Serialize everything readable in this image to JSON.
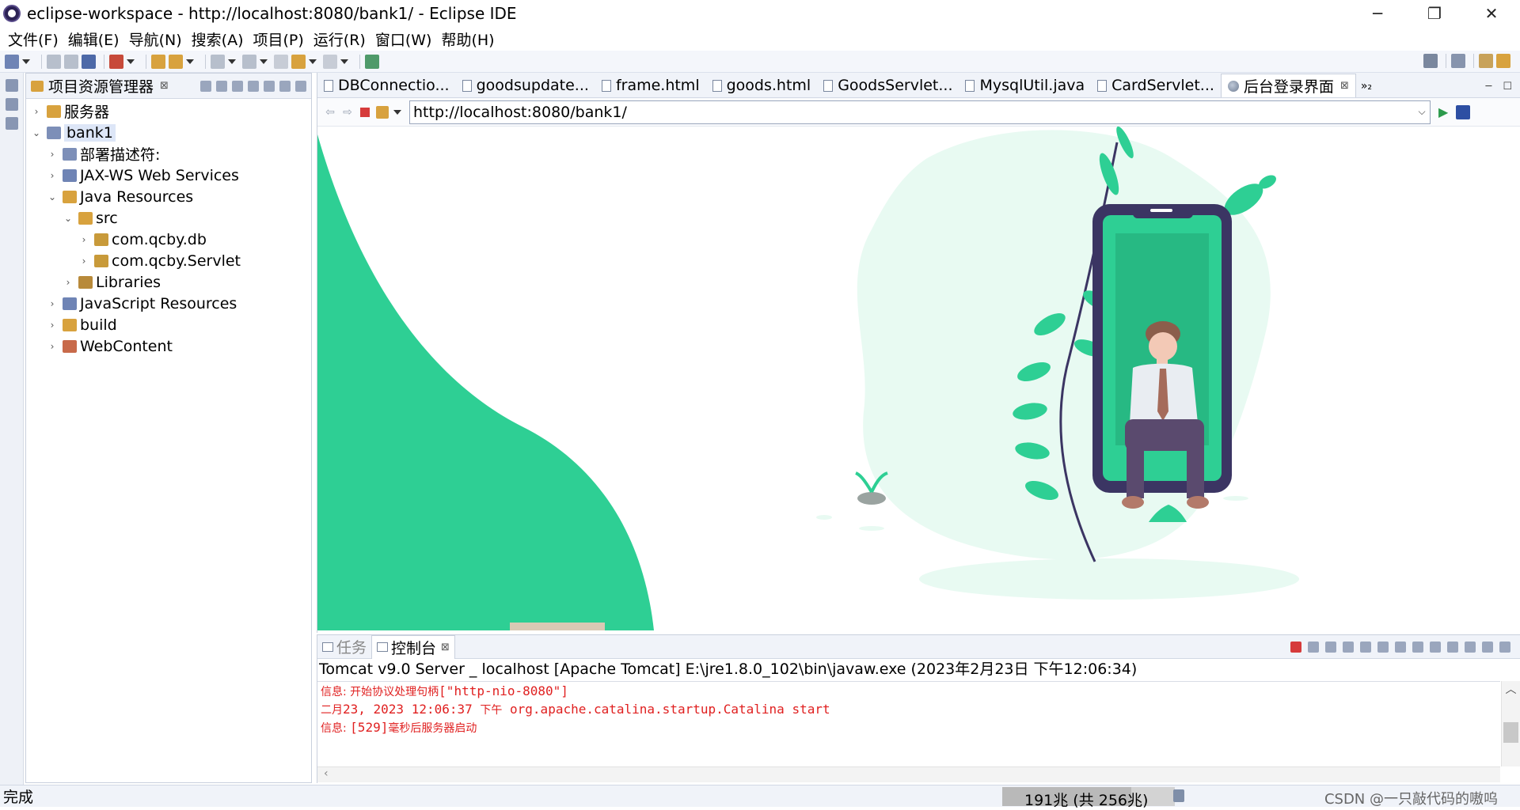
{
  "window": {
    "title": "eclipse-workspace - http://localhost:8080/bank1/ - Eclipse IDE",
    "minimize": "─",
    "maximize": "❐",
    "close": "✕"
  },
  "menubar": {
    "items": [
      {
        "label": "文件(F)"
      },
      {
        "label": "编辑(E)"
      },
      {
        "label": "导航(N)"
      },
      {
        "label": "搜索(A)"
      },
      {
        "label": "项目(P)"
      },
      {
        "label": "运行(R)"
      },
      {
        "label": "窗口(W)"
      },
      {
        "label": "帮助(H)"
      }
    ]
  },
  "explorer": {
    "title": "项目资源管理器",
    "close": "⊠",
    "tree": [
      {
        "label": "服务器",
        "twisty": "›",
        "icon": "folder-icon",
        "color": "#d8a23e",
        "indent": 0
      },
      {
        "label": "bank1",
        "twisty": "⌄",
        "icon": "web-project-icon",
        "color": "#7d8fb8",
        "indent": 0,
        "selected": true
      },
      {
        "label": "部署描述符:",
        "twisty": "›",
        "icon": "deployment-descriptor-icon",
        "color": "#7d8fb8",
        "indent": 1
      },
      {
        "label": "JAX-WS Web Services",
        "twisty": "›",
        "icon": "webservices-icon",
        "color": "#6f84b5",
        "indent": 1
      },
      {
        "label": "Java Resources",
        "twisty": "⌄",
        "icon": "java-resources-icon",
        "color": "#d8a23e",
        "indent": 1
      },
      {
        "label": "src",
        "twisty": "⌄",
        "icon": "source-folder-icon",
        "color": "#d8a23e",
        "indent": 2
      },
      {
        "label": "com.qcby.db",
        "twisty": "›",
        "icon": "package-icon",
        "color": "#c89a3a",
        "indent": 3
      },
      {
        "label": "com.qcby.Servlet",
        "twisty": "›",
        "icon": "package-icon",
        "color": "#c89a3a",
        "indent": 3
      },
      {
        "label": "Libraries",
        "twisty": "›",
        "icon": "libraries-icon",
        "color": "#b88a3a",
        "indent": 2
      },
      {
        "label": "JavaScript Resources",
        "twisty": "›",
        "icon": "js-resources-icon",
        "color": "#6f84b5",
        "indent": 1
      },
      {
        "label": "build",
        "twisty": "›",
        "icon": "folder-icon",
        "color": "#d8a23e",
        "indent": 1
      },
      {
        "label": "WebContent",
        "twisty": "›",
        "icon": "webcontent-folder-icon",
        "color": "#c86a4a",
        "indent": 1
      }
    ]
  },
  "editor": {
    "tabs": [
      {
        "label": "DBConnectio...",
        "icon": "java-file-icon"
      },
      {
        "label": "goodsupdate...",
        "icon": "html-file-icon"
      },
      {
        "label": "frame.html",
        "icon": "html-file-icon"
      },
      {
        "label": "goods.html",
        "icon": "html-file-icon"
      },
      {
        "label": "GoodsServlet...",
        "icon": "java-file-icon"
      },
      {
        "label": "MysqlUtil.java",
        "icon": "java-file-icon"
      },
      {
        "label": "CardServlet...",
        "icon": "java-file-icon"
      },
      {
        "label": "后台登录界面",
        "icon": "globe-icon",
        "active": true,
        "close": "⊠"
      }
    ],
    "overflow": "»₂",
    "browser": {
      "url": "http://localhost:8080/bank1/",
      "back": "⇦",
      "forward": "⇨",
      "go": "▶"
    }
  },
  "console": {
    "tabs": [
      {
        "label": "任务",
        "active": false
      },
      {
        "label": "控制台",
        "active": true,
        "close": "⊠"
      }
    ],
    "launch": "Tomcat v9.0 Server _ localhost [Apache Tomcat] E:\\jre1.8.0_102\\bin\\javaw.exe  (2023年2月23日 下午12:06:34)",
    "lines": [
      {
        "cn": "信息: 开始协议处理句柄",
        "mono": "[\"http-nio-8080\"]"
      },
      {
        "cn": "二月",
        "mono": "23, 2023 12:06:37 ",
        "cn2": "下午",
        "mono2": " org.apache.catalina.startup.Catalina start"
      },
      {
        "cn": "信息: ",
        "mono": "[529]",
        "cn2": "毫秒后服务器启动"
      }
    ]
  },
  "statusbar": {
    "status": "完成",
    "heap": "191兆 (共 256兆)",
    "heap_fraction": 0.746,
    "watermark": "CSDN @一只敲代码的嗷呜"
  },
  "colors": {
    "accent_green": "#2ecf94",
    "light_mint": "#e8faf2",
    "phone_frame": "#3b3563",
    "console_red": "#e02020"
  }
}
